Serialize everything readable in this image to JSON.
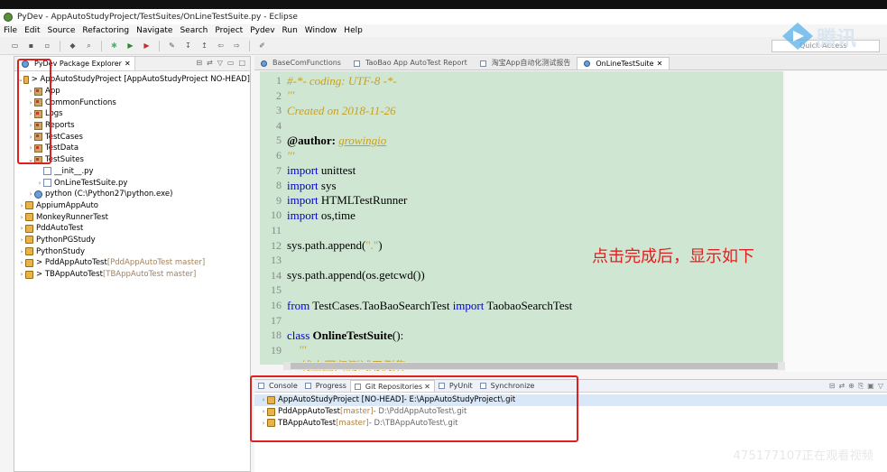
{
  "window": {
    "title": "PyDev - AppAutoStudyProject/TestSuites/OnLineTestSuite.py - Eclipse"
  },
  "menubar": {
    "items": [
      "File",
      "Edit",
      "Source",
      "Refactoring",
      "Navigate",
      "Search",
      "Project",
      "Pydev",
      "Run",
      "Window",
      "Help"
    ]
  },
  "toolbar": {
    "quick_access_placeholder": "Quick Access"
  },
  "logo": {
    "text": "腾讯"
  },
  "package_explorer": {
    "tab_label": "PyDev Package Explorer",
    "items": [
      {
        "label": "> AppAutoStudyProject [AppAutoStudyProject NO-HEAD]",
        "level": 0,
        "expanded": true,
        "icon": "project-icon"
      },
      {
        "label": "App",
        "level": 1,
        "icon": "package-icon"
      },
      {
        "label": "CommonFunctions",
        "level": 1,
        "icon": "package-icon"
      },
      {
        "label": "Logs",
        "level": 1,
        "icon": "package-icon"
      },
      {
        "label": "Reports",
        "level": 1,
        "icon": "package-icon"
      },
      {
        "label": "TestCases",
        "level": 1,
        "icon": "package-icon"
      },
      {
        "label": "TestData",
        "level": 1,
        "icon": "package-icon"
      },
      {
        "label": "TestSuites",
        "level": 1,
        "expanded": true,
        "icon": "package-icon"
      },
      {
        "label": "__init__.py",
        "level": 2,
        "icon": "file-icon"
      },
      {
        "label": "OnLineTestSuite.py",
        "level": 2,
        "icon": "file-icon"
      },
      {
        "label": "python  (C:\\Python27\\python.exe)",
        "level": 1,
        "icon": "python-icon"
      },
      {
        "label": "AppiumAppAuto",
        "level": 0,
        "icon": "project-icon"
      },
      {
        "label": "MonkeyRunnerTest",
        "level": 0,
        "icon": "project-icon"
      },
      {
        "label": "PddAutoTest",
        "level": 0,
        "icon": "project-icon"
      },
      {
        "label": "PythonPGStudy",
        "level": 0,
        "icon": "project-icon"
      },
      {
        "label": "PythonStudy",
        "level": 0,
        "icon": "project-icon"
      },
      {
        "label": "> PddAppAutoTest",
        "suffix": "[PddAppAutoTest master]",
        "level": 0,
        "icon": "project-icon"
      },
      {
        "label": "> TBAppAutoTest",
        "suffix": "[TBAppAutoTest master]",
        "level": 0,
        "icon": "project-icon"
      }
    ]
  },
  "editor": {
    "tabs": [
      "BaseComFunctions",
      "TaoBao App AutoTest Report",
      "淘宝App自动化测试报告",
      "OnLineTestSuite"
    ],
    "active_tab": 3,
    "lines": [
      {
        "n": "1",
        "segs": [
          {
            "t": "#-*- coding: UTF-8 -*-",
            "c": "cm"
          }
        ]
      },
      {
        "n": "2",
        "segs": [
          {
            "t": "'''",
            "c": "cm"
          }
        ]
      },
      {
        "n": "3",
        "segs": [
          {
            "t": "Created on 2018-11-26",
            "c": "cm"
          }
        ]
      },
      {
        "n": "4",
        "segs": []
      },
      {
        "n": "5",
        "segs": [
          {
            "t": "@author: ",
            "c": "bold"
          },
          {
            "t": "growingio",
            "c": "cm underline"
          }
        ]
      },
      {
        "n": "6",
        "segs": [
          {
            "t": "'''",
            "c": "cm"
          }
        ]
      },
      {
        "n": "7",
        "segs": [
          {
            "t": "import",
            "c": "kw"
          },
          {
            "t": " unittest",
            "c": ""
          }
        ]
      },
      {
        "n": "8",
        "segs": [
          {
            "t": "import",
            "c": "kw"
          },
          {
            "t": " sys",
            "c": ""
          }
        ]
      },
      {
        "n": "9",
        "segs": [
          {
            "t": "import",
            "c": "kw"
          },
          {
            "t": " HTMLTestRunner",
            "c": ""
          }
        ]
      },
      {
        "n": "10",
        "segs": [
          {
            "t": "import",
            "c": "kw"
          },
          {
            "t": " os,time",
            "c": ""
          }
        ]
      },
      {
        "n": "11",
        "segs": []
      },
      {
        "n": "12",
        "segs": [
          {
            "t": "sys.path.append(",
            "c": ""
          },
          {
            "t": "\".\"",
            "c": "str"
          },
          {
            "t": ")",
            "c": ""
          }
        ]
      },
      {
        "n": "13",
        "segs": []
      },
      {
        "n": "14",
        "segs": [
          {
            "t": "sys.path.append(os.getcwd())",
            "c": ""
          }
        ]
      },
      {
        "n": "15",
        "segs": []
      },
      {
        "n": "16",
        "segs": [
          {
            "t": "from",
            "c": "kw"
          },
          {
            "t": " TestCases.TaoBaoSearchTest ",
            "c": ""
          },
          {
            "t": "import",
            "c": "kw"
          },
          {
            "t": " TaobaoSearchTest",
            "c": ""
          }
        ]
      },
      {
        "n": "17",
        "segs": []
      },
      {
        "n": "18",
        "segs": [
          {
            "t": "class",
            "c": "kw"
          },
          {
            "t": " ",
            "c": ""
          },
          {
            "t": "OnlineTestSuite",
            "c": "bold"
          },
          {
            "t": "():",
            "c": ""
          }
        ]
      },
      {
        "n": "19",
        "segs": [
          {
            "t": "    '''",
            "c": "cm"
          }
        ]
      },
      {
        "n": "",
        "segs": [
          {
            "t": "    线上回归测试用例集",
            "c": "cm"
          }
        ]
      }
    ]
  },
  "annotation": "点击完成后，显示如下",
  "bottom_panel": {
    "tabs": [
      "Console",
      "Progress",
      "Git Repositories",
      "PyUnit",
      "Synchronize"
    ],
    "active_tab": 2,
    "repos": [
      {
        "name": "AppAutoStudyProject [NO-HEAD]",
        "path": " - E:\\AppAutoStudyProject\\.git",
        "branch": ""
      },
      {
        "name": "PddAppAutoTest",
        "branch": " [master]",
        "path": " - D:\\PddAppAutoTest\\.git"
      },
      {
        "name": "TBAppAutoTest",
        "branch": " [master]",
        "path": " - D:\\TBAppAutoTest\\.git"
      }
    ]
  },
  "watermark": "475177107正在观看视频",
  "colors": {
    "red_box": "#e02020",
    "code_bg": "#cfe6d3",
    "keyword": "#0000c8",
    "comment": "#c8a020"
  }
}
